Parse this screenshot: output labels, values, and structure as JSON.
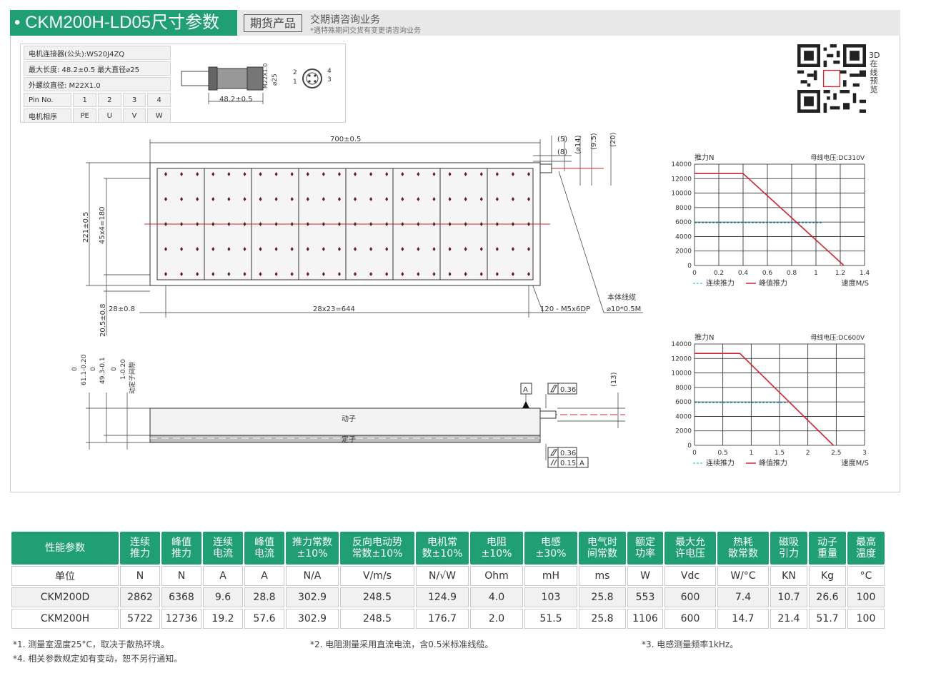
{
  "header": {
    "title": "• CKM200H-LD05尺寸参数",
    "badge": "期货产品",
    "note_main": "交期请咨询业务",
    "note_sub": "*遇特殊期间交货有变更请咨询业务"
  },
  "connector": {
    "row1": "电机连接器(公头):WS20J4ZQ",
    "row2": "最大长度: 48.2±0.5   最大直径⌀25",
    "row3": "外螺纹直径: M22X1.0",
    "pin_label": "Pin No.",
    "pins": [
      "1",
      "2",
      "3",
      "4"
    ],
    "phase_label": "电机相序",
    "phases": [
      "PE",
      "U",
      "V",
      "W"
    ],
    "dim_length": "48.2±0.5",
    "dim_thread": "M22X1.0",
    "dim_dia": "⌀25",
    "pin_marks": [
      "2",
      "4",
      "1",
      "3"
    ]
  },
  "qr_label": "3D在线预览",
  "top_view": {
    "dim_total": "700±0.5",
    "dim_5": "(5)",
    "dim_8": "(8)",
    "dim_phi14": "(⌀14)",
    "dim_95": "(9.5)",
    "dim_20": "(20)",
    "dim_height": "221±0.5",
    "dim_pitch_v": "45x4=180",
    "dim_28": "28±0.8",
    "dim_pitch_h": "28x23=644",
    "dim_205": "20.5±0.8",
    "holes": "120 - M5x6DP",
    "cable_label": "本体线缆",
    "cable_spec": "⌀10*0.5M"
  },
  "side_view": {
    "dim_611": "61.1-0.20",
    "dim_611_top": "0",
    "dim_493": "49.3-0.1",
    "dim_493_top": "0",
    "dim_gap": "1-0.20",
    "dim_gap_top": "0",
    "gap_label": "动定子间隙",
    "mover": "动子",
    "stator": "定子",
    "datum": "A",
    "flat_top": "0.36",
    "flat_bottom": "0.36",
    "parallel": "0.15",
    "dim_13": "(13)"
  },
  "chart_data": [
    {
      "type": "line",
      "ylabel": "推力N",
      "xlabel": "速度M/S",
      "annotation": "母线电压:DC310V",
      "ylim": [
        0,
        14000
      ],
      "xlim": [
        0,
        1.4
      ],
      "yticks": [
        "0",
        "2000",
        "4000",
        "6000",
        "8000",
        "10000",
        "12000",
        "14000"
      ],
      "xticks": [
        "0",
        "0.2",
        "0.4",
        "0.6",
        "0.8",
        "1",
        "1.2",
        "1.4"
      ],
      "series": [
        {
          "name": "连续推力",
          "x": [
            0,
            1.05
          ],
          "y": [
            5900,
            5900
          ],
          "color": "#2ba6d8",
          "dash": true
        },
        {
          "name": "峰值推力",
          "x": [
            0,
            0.4,
            1.23
          ],
          "y": [
            12700,
            12700,
            0
          ],
          "color": "#d12530",
          "dash": false
        }
      ]
    },
    {
      "type": "line",
      "ylabel": "推力N",
      "xlabel": "速度M/S",
      "annotation": "母线电压:DC600V",
      "ylim": [
        0,
        14000
      ],
      "xlim": [
        0,
        3
      ],
      "yticks": [
        "0",
        "2000",
        "4000",
        "6000",
        "8000",
        "10000",
        "12000",
        "14000"
      ],
      "xticks": [
        "0",
        "0.5",
        "1",
        "1.5",
        "2",
        "2.5",
        "3"
      ],
      "series": [
        {
          "name": "连续推力",
          "x": [
            0,
            1.65
          ],
          "y": [
            5900,
            5900
          ],
          "color": "#2ba6d8",
          "dash": true
        },
        {
          "name": "峰值推力",
          "x": [
            0,
            0.8,
            2.45
          ],
          "y": [
            12700,
            12700,
            0
          ],
          "color": "#d12530",
          "dash": false
        }
      ]
    }
  ],
  "spec_table": {
    "headers": [
      "性能参数",
      "连续\n推力",
      "峰值\n推力",
      "连续\n电流",
      "峰值\n电流",
      "推力常数\n±10%",
      "反向电动势\n常数±10%",
      "电机常\n数±10%",
      "电阻\n±10%",
      "电感\n±30%",
      "电气时\n间常数",
      "额定\n功率",
      "最大允\n许电压",
      "热耗\n散常数",
      "磁吸\n引力",
      "动子\n重量",
      "最高\n温度"
    ],
    "rows": [
      [
        "单位",
        "N",
        "N",
        "A",
        "A",
        "N/A",
        "V/m/s",
        "N/√W",
        "Ohm",
        "mH",
        "ms",
        "W",
        "Vdc",
        "W/°C",
        "KN",
        "Kg",
        "°C"
      ],
      [
        "CKM200D",
        "2862",
        "6368",
        "9.6",
        "28.8",
        "302.9",
        "248.5",
        "124.9",
        "4.0",
        "103",
        "25.8",
        "553",
        "600",
        "7.4",
        "10.7",
        "26.6",
        "100"
      ],
      [
        "CKM200H",
        "5722",
        "12736",
        "19.2",
        "57.6",
        "302.9",
        "248.5",
        "176.7",
        "2.0",
        "51.5",
        "25.8",
        "1106",
        "600",
        "14.7",
        "21.4",
        "51.7",
        "100"
      ]
    ]
  },
  "footnotes": {
    "n1": "*1. 测量室温度25°C，取决于散热环境。",
    "n2": "*2. 电阻测量采用直流电流，含0.5米标准线缆。",
    "n3": "*3. 电感测量频率1kHz。",
    "n4": "*4. 相关参数规定如有变动，恕不另行通知。"
  }
}
